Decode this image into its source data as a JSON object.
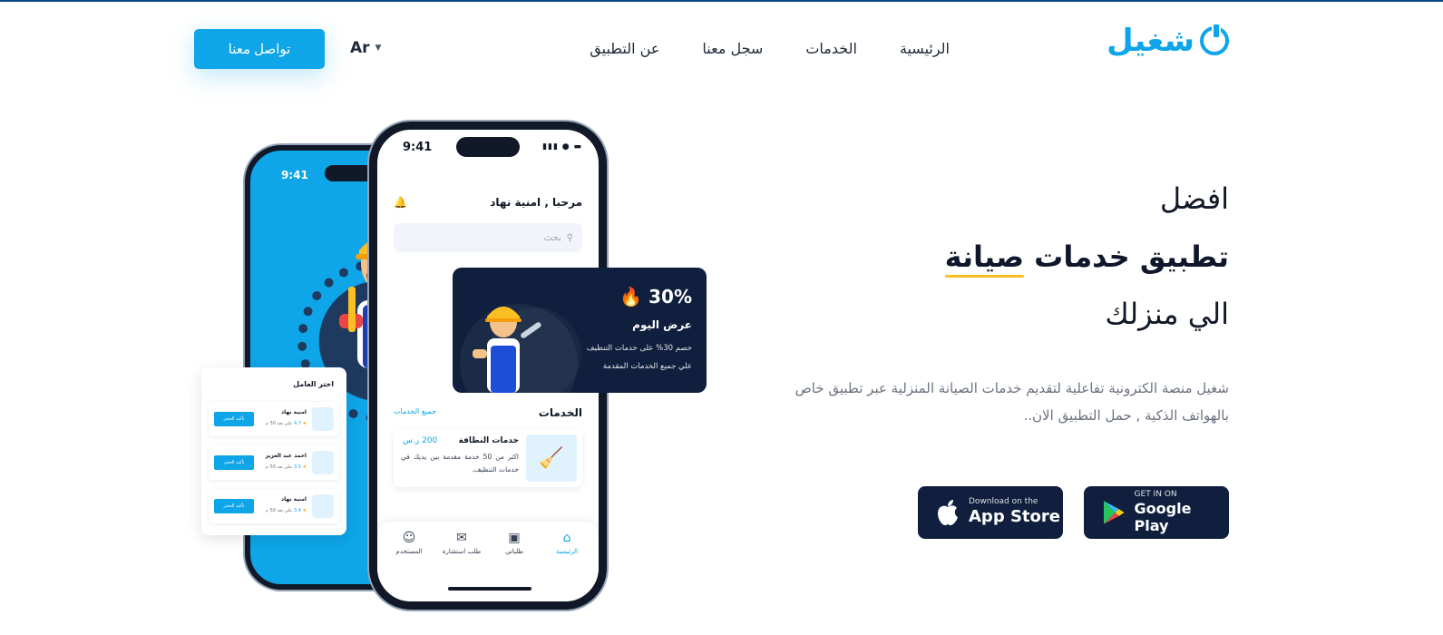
{
  "brand": {
    "logo_text": "شغيل",
    "accent": "#0ea5e9",
    "dark": "#0f1f3d"
  },
  "nav": {
    "links": [
      "الرئيسية",
      "الخدمات",
      "سجل معنا",
      "عن التطبيق"
    ],
    "lang": "Ar",
    "contact_label": "تواصل معنا"
  },
  "hero": {
    "line1": "افضل",
    "line2_a": "تطبيق خدمات",
    "line2_b": "صيانة",
    "line3": "الي منزلك",
    "description": "شغيل منصة الكترونية تفاعلية لتقديم خدمات الصيانة المنزلية عبر تطبيق خاص بالهواتف الذكية , حمل التطبيق الان.."
  },
  "stores": {
    "google_small": "GET IN ON",
    "google_big": "Google Play",
    "apple_small": "Download on the",
    "apple_big": "App Store"
  },
  "phone_back": {
    "time": "9:41"
  },
  "phone_front": {
    "time": "9:41",
    "greeting": "مرحبا , امنية نهاد",
    "search_placeholder": "بحث",
    "services_title": "الخدمات",
    "all_services": "جميع الخدمات",
    "service_card": {
      "title": "خدمات النظافة",
      "price": "200 ر.س",
      "description": "اكثر من 50 خدمة مقدمة بين يديك في خدمات التنظيف."
    },
    "tabs": [
      {
        "label": "الرئيسية",
        "icon": "home-icon",
        "active": true
      },
      {
        "label": "طلباتي",
        "icon": "calendar-icon",
        "active": false
      },
      {
        "label": "طلب استشارة",
        "icon": "chat-icon",
        "active": false
      },
      {
        "label": "المستخدم",
        "icon": "user-icon",
        "active": false
      }
    ]
  },
  "offer": {
    "percent": "30%",
    "title": "عرض اليوم",
    "line1": "خصم 30% على خدمات التنظيف",
    "line2": "علي جميع الخدمات المقدمة"
  },
  "worker_list": {
    "title": "اختر العامل",
    "book_label": "تأكيد الحجز",
    "workers": [
      {
        "name": "امنية نهاد",
        "rating": "4.7",
        "reviews": "علي بعد 50 م"
      },
      {
        "name": "احمد عبد العزيز",
        "rating": "3.5",
        "reviews": "علي بعد 50 م"
      },
      {
        "name": "امنية نهاد",
        "rating": "3.4",
        "reviews": "علي بعد 50 م"
      }
    ]
  }
}
